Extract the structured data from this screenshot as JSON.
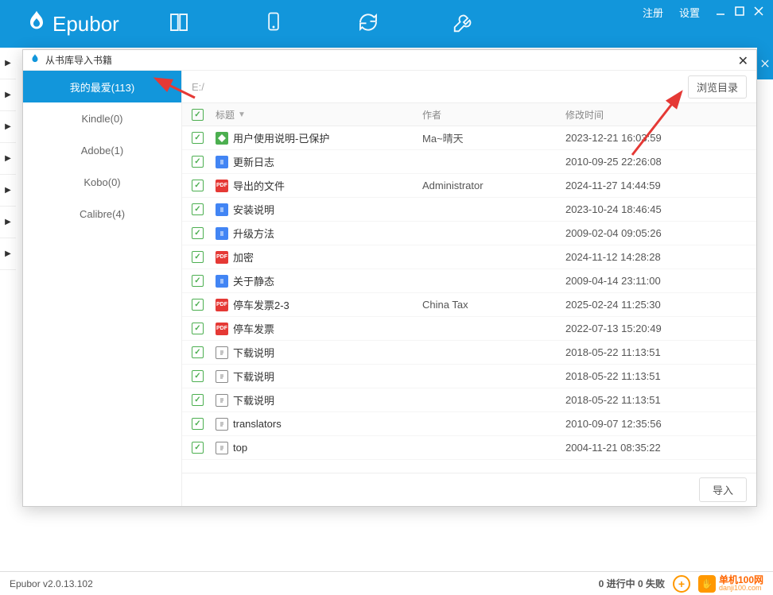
{
  "header": {
    "logo_text": "Epubor",
    "register": "注册",
    "settings": "设置"
  },
  "modal": {
    "title": "从书库导入书籍",
    "path": "E:/",
    "browse_label": "浏览目录",
    "import_label": "导入",
    "columns": {
      "title": "标题",
      "author": "作者",
      "date": "修改时间"
    }
  },
  "sidebar": [
    {
      "label": "我的最爱(113)",
      "active": true
    },
    {
      "label": "Kindle(0)",
      "active": false
    },
    {
      "label": "Adobe(1)",
      "active": false
    },
    {
      "label": "Kobo(0)",
      "active": false
    },
    {
      "label": "Calibre(4)",
      "active": false
    }
  ],
  "files": [
    {
      "title": "用户使用说明-已保护",
      "author": "Ma~晴天",
      "date": "2023-12-21 16:03:59",
      "type": "epub"
    },
    {
      "title": "更新日志",
      "author": "",
      "date": "2010-09-25 22:26:08",
      "type": "doc"
    },
    {
      "title": "导出的文件",
      "author": "Administrator",
      "date": "2024-11-27 14:44:59",
      "type": "pdf"
    },
    {
      "title": "安装说明",
      "author": "",
      "date": "2023-10-24 18:46:45",
      "type": "doc"
    },
    {
      "title": "升级方法",
      "author": "",
      "date": "2009-02-04 09:05:26",
      "type": "doc"
    },
    {
      "title": "加密",
      "author": "",
      "date": "2024-11-12 14:28:28",
      "type": "pdf"
    },
    {
      "title": "关于静态",
      "author": "",
      "date": "2009-04-14 23:11:00",
      "type": "doc"
    },
    {
      "title": "停车发票2-3",
      "author": "China Tax",
      "date": "2025-02-24 11:25:30",
      "type": "pdf"
    },
    {
      "title": "停车发票",
      "author": "",
      "date": "2022-07-13 15:20:49",
      "type": "pdf"
    },
    {
      "title": "下载说明",
      "author": "",
      "date": "2018-05-22 11:13:51",
      "type": "txt"
    },
    {
      "title": "下载说明",
      "author": "",
      "date": "2018-05-22 11:13:51",
      "type": "txt"
    },
    {
      "title": "下载说明",
      "author": "",
      "date": "2018-05-22 11:13:51",
      "type": "txt"
    },
    {
      "title": "translators",
      "author": "",
      "date": "2010-09-07 12:35:56",
      "type": "txt"
    },
    {
      "title": "top",
      "author": "",
      "date": "2004-11-21 08:35:22",
      "type": "txt"
    }
  ],
  "status": {
    "version": "Epubor v2.0.13.102",
    "progress": "0 进行中  0 失败",
    "watermark_title": "单机100网",
    "watermark_url": "danji100.com"
  }
}
